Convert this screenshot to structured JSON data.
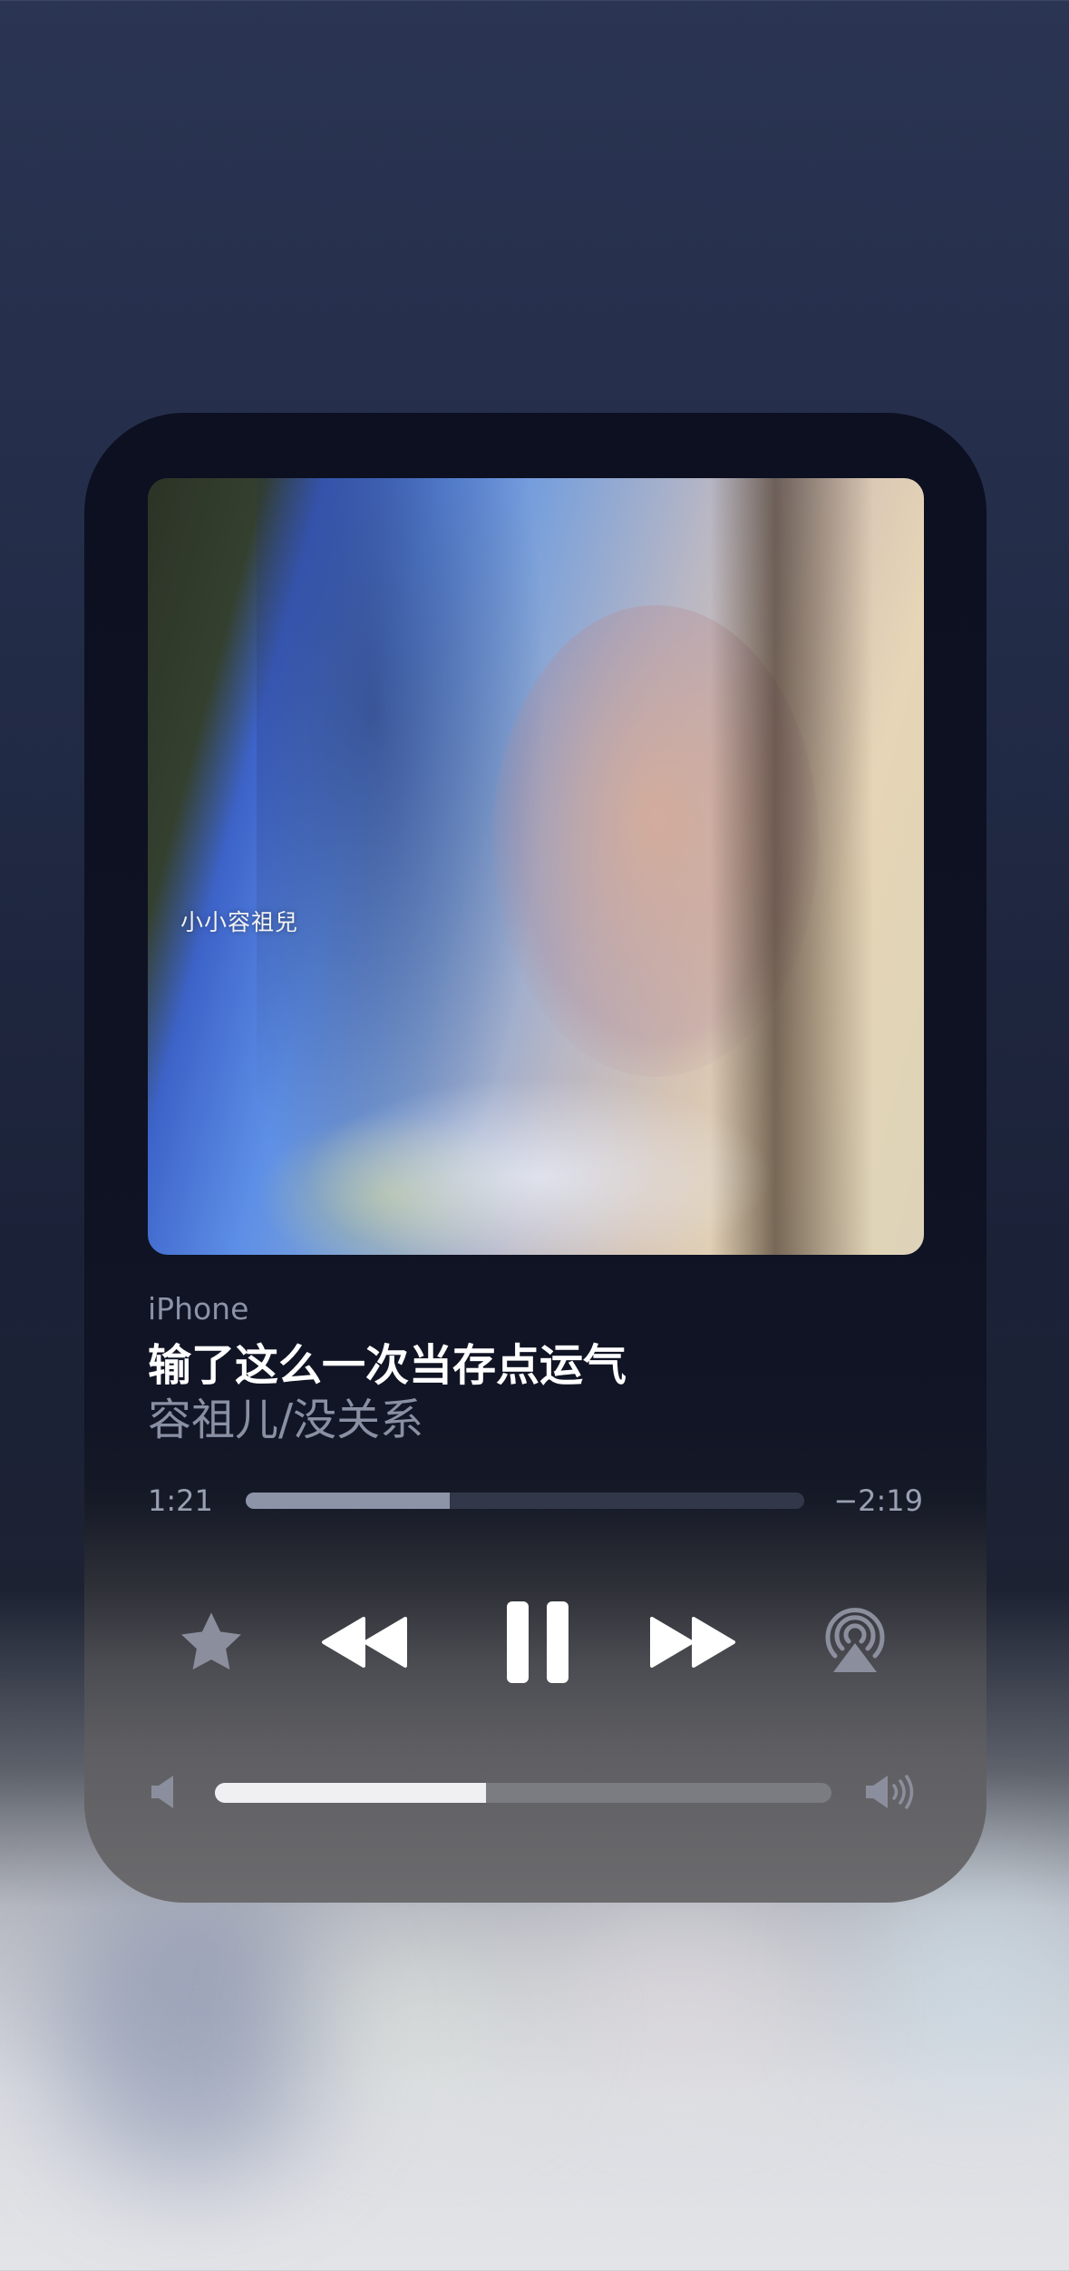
{
  "player": {
    "output_device": "iPhone",
    "track_title": "输了这么一次当存点运气",
    "track_subtitle": "容祖儿/没关系",
    "artwork_text": "小小容祖兒",
    "elapsed": "1:21",
    "remaining": "−2:19",
    "progress_fraction": 0.365,
    "volume_fraction": 0.44
  },
  "controls": {
    "favorite_icon": "star-icon",
    "rewind_icon": "rewind-icon",
    "pause_icon": "pause-icon",
    "forward_icon": "fast-forward-icon",
    "airplay_icon": "airplay-audio-icon",
    "volume_low_icon": "speaker-low-icon",
    "volume_high_icon": "speaker-high-icon"
  },
  "colors": {
    "card_background": "#0c1021",
    "title_text": "#ffffff",
    "secondary_text": "#8a90a4",
    "progress_fill": "#8e94a8",
    "volume_fill": "#f0f0f2"
  }
}
